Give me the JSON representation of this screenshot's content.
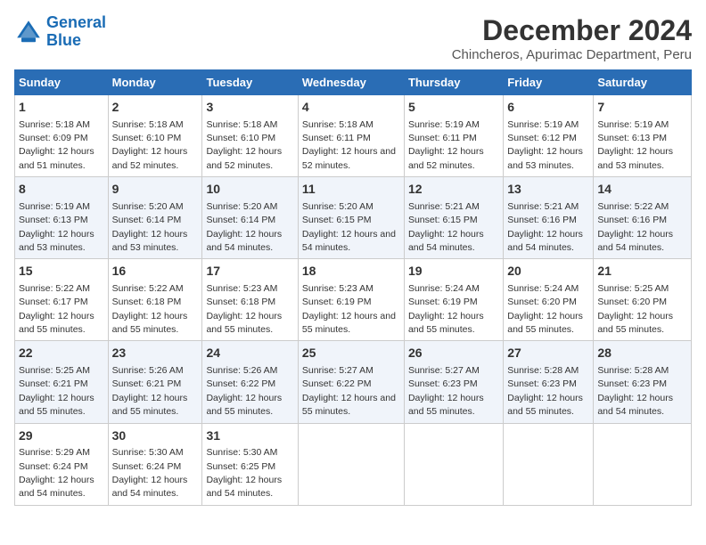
{
  "logo": {
    "line1": "General",
    "line2": "Blue"
  },
  "title": "December 2024",
  "subtitle": "Chincheros, Apurimac Department, Peru",
  "days_of_week": [
    "Sunday",
    "Monday",
    "Tuesday",
    "Wednesday",
    "Thursday",
    "Friday",
    "Saturday"
  ],
  "weeks": [
    [
      {
        "day": "1",
        "sunrise": "5:18 AM",
        "sunset": "6:09 PM",
        "daylight": "12 hours and 51 minutes."
      },
      {
        "day": "2",
        "sunrise": "5:18 AM",
        "sunset": "6:10 PM",
        "daylight": "12 hours and 52 minutes."
      },
      {
        "day": "3",
        "sunrise": "5:18 AM",
        "sunset": "6:10 PM",
        "daylight": "12 hours and 52 minutes."
      },
      {
        "day": "4",
        "sunrise": "5:18 AM",
        "sunset": "6:11 PM",
        "daylight": "12 hours and 52 minutes."
      },
      {
        "day": "5",
        "sunrise": "5:19 AM",
        "sunset": "6:11 PM",
        "daylight": "12 hours and 52 minutes."
      },
      {
        "day": "6",
        "sunrise": "5:19 AM",
        "sunset": "6:12 PM",
        "daylight": "12 hours and 53 minutes."
      },
      {
        "day": "7",
        "sunrise": "5:19 AM",
        "sunset": "6:13 PM",
        "daylight": "12 hours and 53 minutes."
      }
    ],
    [
      {
        "day": "8",
        "sunrise": "5:19 AM",
        "sunset": "6:13 PM",
        "daylight": "12 hours and 53 minutes."
      },
      {
        "day": "9",
        "sunrise": "5:20 AM",
        "sunset": "6:14 PM",
        "daylight": "12 hours and 53 minutes."
      },
      {
        "day": "10",
        "sunrise": "5:20 AM",
        "sunset": "6:14 PM",
        "daylight": "12 hours and 54 minutes."
      },
      {
        "day": "11",
        "sunrise": "5:20 AM",
        "sunset": "6:15 PM",
        "daylight": "12 hours and 54 minutes."
      },
      {
        "day": "12",
        "sunrise": "5:21 AM",
        "sunset": "6:15 PM",
        "daylight": "12 hours and 54 minutes."
      },
      {
        "day": "13",
        "sunrise": "5:21 AM",
        "sunset": "6:16 PM",
        "daylight": "12 hours and 54 minutes."
      },
      {
        "day": "14",
        "sunrise": "5:22 AM",
        "sunset": "6:16 PM",
        "daylight": "12 hours and 54 minutes."
      }
    ],
    [
      {
        "day": "15",
        "sunrise": "5:22 AM",
        "sunset": "6:17 PM",
        "daylight": "12 hours and 55 minutes."
      },
      {
        "day": "16",
        "sunrise": "5:22 AM",
        "sunset": "6:18 PM",
        "daylight": "12 hours and 55 minutes."
      },
      {
        "day": "17",
        "sunrise": "5:23 AM",
        "sunset": "6:18 PM",
        "daylight": "12 hours and 55 minutes."
      },
      {
        "day": "18",
        "sunrise": "5:23 AM",
        "sunset": "6:19 PM",
        "daylight": "12 hours and 55 minutes."
      },
      {
        "day": "19",
        "sunrise": "5:24 AM",
        "sunset": "6:19 PM",
        "daylight": "12 hours and 55 minutes."
      },
      {
        "day": "20",
        "sunrise": "5:24 AM",
        "sunset": "6:20 PM",
        "daylight": "12 hours and 55 minutes."
      },
      {
        "day": "21",
        "sunrise": "5:25 AM",
        "sunset": "6:20 PM",
        "daylight": "12 hours and 55 minutes."
      }
    ],
    [
      {
        "day": "22",
        "sunrise": "5:25 AM",
        "sunset": "6:21 PM",
        "daylight": "12 hours and 55 minutes."
      },
      {
        "day": "23",
        "sunrise": "5:26 AM",
        "sunset": "6:21 PM",
        "daylight": "12 hours and 55 minutes."
      },
      {
        "day": "24",
        "sunrise": "5:26 AM",
        "sunset": "6:22 PM",
        "daylight": "12 hours and 55 minutes."
      },
      {
        "day": "25",
        "sunrise": "5:27 AM",
        "sunset": "6:22 PM",
        "daylight": "12 hours and 55 minutes."
      },
      {
        "day": "26",
        "sunrise": "5:27 AM",
        "sunset": "6:23 PM",
        "daylight": "12 hours and 55 minutes."
      },
      {
        "day": "27",
        "sunrise": "5:28 AM",
        "sunset": "6:23 PM",
        "daylight": "12 hours and 55 minutes."
      },
      {
        "day": "28",
        "sunrise": "5:28 AM",
        "sunset": "6:23 PM",
        "daylight": "12 hours and 54 minutes."
      }
    ],
    [
      {
        "day": "29",
        "sunrise": "5:29 AM",
        "sunset": "6:24 PM",
        "daylight": "12 hours and 54 minutes."
      },
      {
        "day": "30",
        "sunrise": "5:30 AM",
        "sunset": "6:24 PM",
        "daylight": "12 hours and 54 minutes."
      },
      {
        "day": "31",
        "sunrise": "5:30 AM",
        "sunset": "6:25 PM",
        "daylight": "12 hours and 54 minutes."
      },
      null,
      null,
      null,
      null
    ]
  ]
}
